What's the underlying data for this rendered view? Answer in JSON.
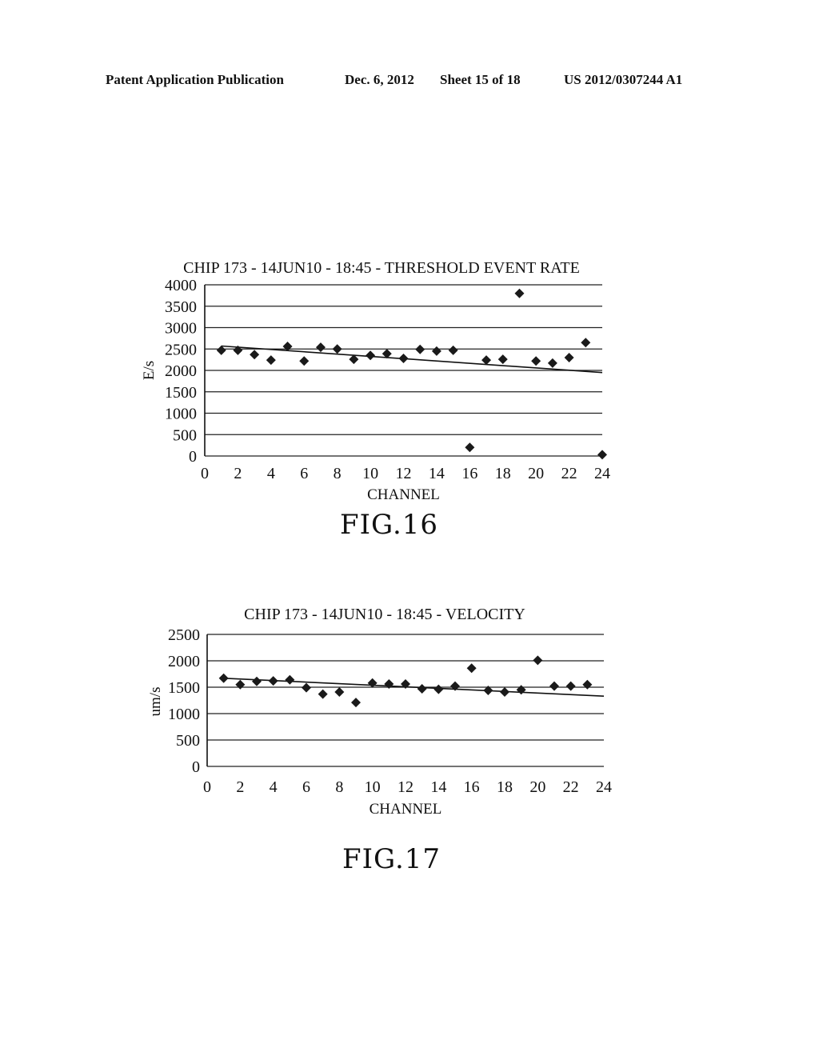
{
  "header": {
    "publication": "Patent Application Publication",
    "date": "Dec. 6, 2012",
    "sheet": "Sheet 15 of 18",
    "number": "US 2012/0307244 A1"
  },
  "figures": [
    {
      "label": "FIG.16"
    },
    {
      "label": "FIG.17"
    }
  ],
  "chart_data": [
    {
      "type": "scatter",
      "title": "CHIP 173 - 14JUN10 - 18:45 -  THRESHOLD EVENT RATE",
      "xlabel": "CHANNEL",
      "ylabel": "E/s",
      "xlim": [
        0,
        24
      ],
      "ylim": [
        0,
        4000
      ],
      "x_ticks": [
        0,
        2,
        4,
        6,
        8,
        10,
        12,
        14,
        16,
        18,
        20,
        22,
        24
      ],
      "y_ticks": [
        0,
        500,
        1000,
        1500,
        2000,
        2500,
        3000,
        3500,
        4000
      ],
      "grid": "horizontal",
      "legend": "none",
      "marker": "diamond",
      "x": [
        1,
        2,
        3,
        4,
        5,
        6,
        7,
        8,
        9,
        10,
        11,
        12,
        13,
        14,
        15,
        16,
        17,
        18,
        19,
        20,
        21,
        22,
        23,
        24
      ],
      "y": [
        2470,
        2470,
        2370,
        2240,
        2560,
        2220,
        2540,
        2500,
        2260,
        2350,
        2390,
        2280,
        2490,
        2450,
        2470,
        200,
        2240,
        2260,
        3800,
        2220,
        2170,
        2300,
        2650,
        30
      ],
      "trendline": {
        "x": [
          1,
          24
        ],
        "y": [
          2570,
          1950
        ]
      }
    },
    {
      "type": "scatter",
      "title": "CHIP 173 - 14JUN10 - 18:45 - VELOCITY",
      "xlabel": "CHANNEL",
      "ylabel": "um/s",
      "xlim": [
        0,
        24
      ],
      "ylim": [
        0,
        2500
      ],
      "x_ticks": [
        0,
        2,
        4,
        6,
        8,
        10,
        12,
        14,
        16,
        18,
        20,
        22,
        24
      ],
      "y_ticks": [
        0,
        500,
        1000,
        1500,
        2000,
        2500
      ],
      "grid": "horizontal",
      "legend": "none",
      "marker": "diamond",
      "x": [
        1,
        2,
        3,
        4,
        5,
        6,
        7,
        8,
        9,
        10,
        11,
        12,
        13,
        14,
        15,
        16,
        17,
        18,
        19,
        20,
        21,
        22,
        23
      ],
      "y": [
        1670,
        1550,
        1610,
        1620,
        1640,
        1490,
        1370,
        1410,
        1210,
        1580,
        1560,
        1560,
        1470,
        1460,
        1520,
        1860,
        1440,
        1410,
        1450,
        2010,
        1520,
        1520,
        1550
      ],
      "trendline": {
        "x": [
          1,
          24
        ],
        "y": [
          1670,
          1330
        ]
      }
    }
  ]
}
